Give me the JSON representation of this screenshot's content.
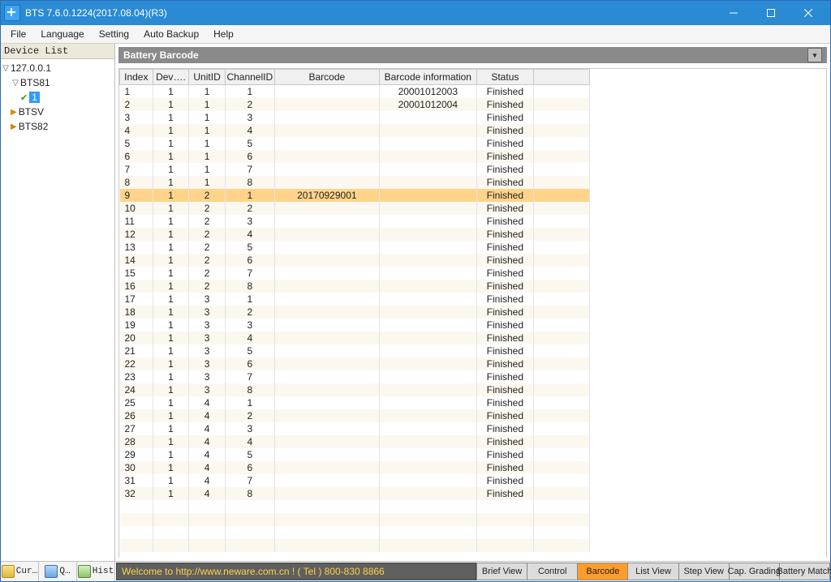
{
  "window": {
    "title": "BTS 7.6.0.1224(2017.08.04)(R3)"
  },
  "menu": {
    "items": [
      "File",
      "Language",
      "Setting",
      "Auto Backup",
      "Help"
    ]
  },
  "sidebar": {
    "title": "Device List",
    "root": "127.0.0.1",
    "nodes": {
      "bts81": "BTS81",
      "ch1": "1",
      "btsv": "BTSV",
      "bts82": "BTS82"
    },
    "tabs": {
      "cur": "Cur…",
      "q": "Q…",
      "hist": "Hist"
    }
  },
  "panel": {
    "title": "Battery Barcode"
  },
  "grid": {
    "columns": [
      "Index",
      "Dev….",
      "UnitID",
      "ChannelID",
      "Barcode",
      "Barcode information",
      "Status",
      ""
    ],
    "rows": [
      {
        "idx": "1",
        "dev": "1",
        "unit": "1",
        "ch": "1",
        "bc": "",
        "info": "20001012003",
        "st": "Finished"
      },
      {
        "idx": "2",
        "dev": "1",
        "unit": "1",
        "ch": "2",
        "bc": "",
        "info": "20001012004",
        "st": "Finished"
      },
      {
        "idx": "3",
        "dev": "1",
        "unit": "1",
        "ch": "3",
        "bc": "",
        "info": "",
        "st": "Finished"
      },
      {
        "idx": "4",
        "dev": "1",
        "unit": "1",
        "ch": "4",
        "bc": "",
        "info": "",
        "st": "Finished"
      },
      {
        "idx": "5",
        "dev": "1",
        "unit": "1",
        "ch": "5",
        "bc": "",
        "info": "",
        "st": "Finished"
      },
      {
        "idx": "6",
        "dev": "1",
        "unit": "1",
        "ch": "6",
        "bc": "",
        "info": "",
        "st": "Finished"
      },
      {
        "idx": "7",
        "dev": "1",
        "unit": "1",
        "ch": "7",
        "bc": "",
        "info": "",
        "st": "Finished"
      },
      {
        "idx": "8",
        "dev": "1",
        "unit": "1",
        "ch": "8",
        "bc": "",
        "info": "",
        "st": "Finished"
      },
      {
        "idx": "9",
        "dev": "1",
        "unit": "2",
        "ch": "1",
        "bc": "20170929001",
        "info": "",
        "st": "Finished",
        "sel": true
      },
      {
        "idx": "10",
        "dev": "1",
        "unit": "2",
        "ch": "2",
        "bc": "",
        "info": "",
        "st": "Finished"
      },
      {
        "idx": "11",
        "dev": "1",
        "unit": "2",
        "ch": "3",
        "bc": "",
        "info": "",
        "st": "Finished"
      },
      {
        "idx": "12",
        "dev": "1",
        "unit": "2",
        "ch": "4",
        "bc": "",
        "info": "",
        "st": "Finished"
      },
      {
        "idx": "13",
        "dev": "1",
        "unit": "2",
        "ch": "5",
        "bc": "",
        "info": "",
        "st": "Finished"
      },
      {
        "idx": "14",
        "dev": "1",
        "unit": "2",
        "ch": "6",
        "bc": "",
        "info": "",
        "st": "Finished"
      },
      {
        "idx": "15",
        "dev": "1",
        "unit": "2",
        "ch": "7",
        "bc": "",
        "info": "",
        "st": "Finished"
      },
      {
        "idx": "16",
        "dev": "1",
        "unit": "2",
        "ch": "8",
        "bc": "",
        "info": "",
        "st": "Finished"
      },
      {
        "idx": "17",
        "dev": "1",
        "unit": "3",
        "ch": "1",
        "bc": "",
        "info": "",
        "st": "Finished"
      },
      {
        "idx": "18",
        "dev": "1",
        "unit": "3",
        "ch": "2",
        "bc": "",
        "info": "",
        "st": "Finished"
      },
      {
        "idx": "19",
        "dev": "1",
        "unit": "3",
        "ch": "3",
        "bc": "",
        "info": "",
        "st": "Finished"
      },
      {
        "idx": "20",
        "dev": "1",
        "unit": "3",
        "ch": "4",
        "bc": "",
        "info": "",
        "st": "Finished"
      },
      {
        "idx": "21",
        "dev": "1",
        "unit": "3",
        "ch": "5",
        "bc": "",
        "info": "",
        "st": "Finished"
      },
      {
        "idx": "22",
        "dev": "1",
        "unit": "3",
        "ch": "6",
        "bc": "",
        "info": "",
        "st": "Finished"
      },
      {
        "idx": "23",
        "dev": "1",
        "unit": "3",
        "ch": "7",
        "bc": "",
        "info": "",
        "st": "Finished"
      },
      {
        "idx": "24",
        "dev": "1",
        "unit": "3",
        "ch": "8",
        "bc": "",
        "info": "",
        "st": "Finished"
      },
      {
        "idx": "25",
        "dev": "1",
        "unit": "4",
        "ch": "1",
        "bc": "",
        "info": "",
        "st": "Finished"
      },
      {
        "idx": "26",
        "dev": "1",
        "unit": "4",
        "ch": "2",
        "bc": "",
        "info": "",
        "st": "Finished"
      },
      {
        "idx": "27",
        "dev": "1",
        "unit": "4",
        "ch": "3",
        "bc": "",
        "info": "",
        "st": "Finished"
      },
      {
        "idx": "28",
        "dev": "1",
        "unit": "4",
        "ch": "4",
        "bc": "",
        "info": "",
        "st": "Finished"
      },
      {
        "idx": "29",
        "dev": "1",
        "unit": "4",
        "ch": "5",
        "bc": "",
        "info": "",
        "st": "Finished"
      },
      {
        "idx": "30",
        "dev": "1",
        "unit": "4",
        "ch": "6",
        "bc": "",
        "info": "",
        "st": "Finished"
      },
      {
        "idx": "31",
        "dev": "1",
        "unit": "4",
        "ch": "7",
        "bc": "",
        "info": "",
        "st": "Finished"
      },
      {
        "idx": "32",
        "dev": "1",
        "unit": "4",
        "ch": "8",
        "bc": "",
        "info": "",
        "st": "Finished"
      }
    ]
  },
  "footer": {
    "marquee": "Welcome to http://www.neware.com.cn !    ( Tel ) 800-830 8866",
    "tabs": [
      "Brief View",
      "Control",
      "Barcode",
      "List View",
      "Step View",
      "Cap. Grading",
      "Battery Match"
    ],
    "active": 2
  }
}
